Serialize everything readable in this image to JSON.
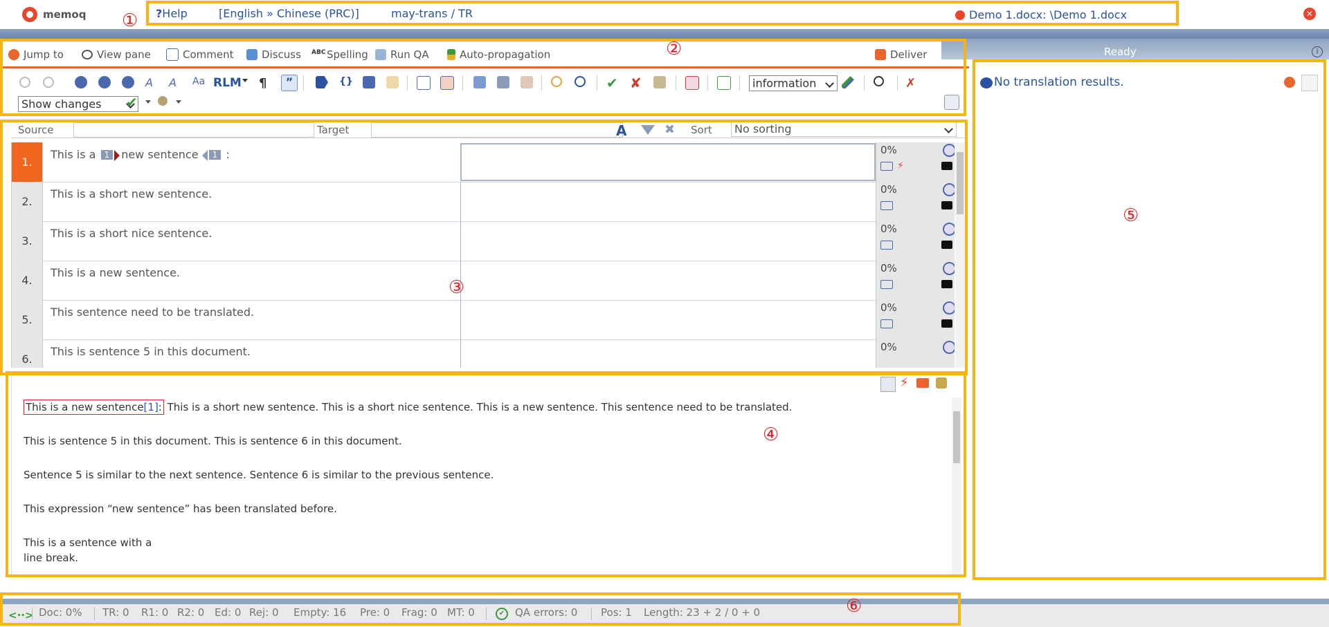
{
  "title_bar": {
    "logo_text": "memoq",
    "help_label": "Help",
    "language_pair": "[English » Chinese (PRC)]",
    "project": "may-trans / TR",
    "document_tab": "Demo 1.docx: \\Demo 1.docx",
    "close_icon": "close-icon"
  },
  "ribbon": {
    "items": [
      "Jump to",
      "View pane",
      "Comment",
      "Discuss",
      "Spelling",
      "Run QA",
      "Auto-propagation"
    ],
    "deliver_label": "Deliver",
    "status": "Ready"
  },
  "toolbar": {
    "rlm_label": "RLM",
    "severity_select": "information",
    "show_changes_select": "Show changes"
  },
  "filter": {
    "source_label": "Source",
    "target_label": "Target",
    "sort_label": "Sort",
    "sort_value": "No sorting"
  },
  "segments": [
    {
      "num": "1.",
      "pre": "This is a",
      "tag_open": "1",
      "mid": "new sentence",
      "tag_close": "1",
      "post": ":",
      "pct": "0%"
    },
    {
      "num": "2.",
      "text": "This is a short new sentence.",
      "pct": "0%"
    },
    {
      "num": "3.",
      "text": "This is a short nice sentence.",
      "pct": "0%"
    },
    {
      "num": "4.",
      "text": "This is a new sentence.",
      "pct": "0%"
    },
    {
      "num": "5.",
      "text": "This sentence need to be translated.",
      "pct": "0%"
    },
    {
      "num": "6.",
      "text": "This is sentence 5 in this document.",
      "pct": "0%"
    }
  ],
  "preview": {
    "p1_highlight_pre": "This is a new sentence",
    "p1_highlight_tag": "[1]",
    "p1_highlight_post": ":",
    "p1_rest": "This is a short new sentence. This is a short nice sentence. This is a new sentence. This sentence need to be translated.",
    "p2": "This is sentence 5 in this document. This is sentence 6 in this document.",
    "p3": "Sentence 5 is similar to the next sentence. Sentence 6 is similar to the previous sentence.",
    "p4": "This expression “new sentence” has been translated before.",
    "p5_line1": "This is a sentence with a",
    "p5_line2": "line break."
  },
  "translation_results": {
    "message": "No translation results."
  },
  "status_bar": {
    "doc": "Doc: 0%",
    "tr": "TR: 0",
    "r1": "R1: 0",
    "r2": "R2: 0",
    "ed": "Ed: 0",
    "rej": "Rej: 0",
    "empty": "Empty: 16",
    "pre": "Pre: 0",
    "frag": "Frag: 0",
    "mt": "MT: 0",
    "qa": "QA errors: 0",
    "pos": "Pos: 1",
    "length": "Length: 23 + 2 / 0 + 0"
  },
  "annotations": [
    "①",
    "②",
    "③",
    "④",
    "⑤",
    "⑥"
  ],
  "colors": {
    "accent": "#f0661f",
    "annotation_border": "#f5b614",
    "annotation_number": "#e02020",
    "link_blue": "#2a52a0"
  }
}
